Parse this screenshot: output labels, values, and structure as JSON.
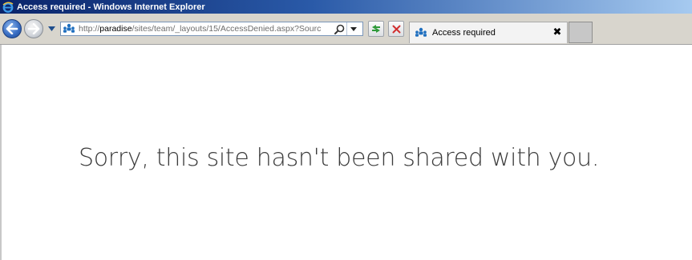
{
  "window": {
    "title": "Access required - Windows Internet Explorer"
  },
  "toolbar": {
    "back_icon": "back-arrow-icon",
    "forward_icon": "forward-arrow-icon",
    "address": {
      "prefix": "http://",
      "host": "paradise",
      "path": "/sites/team/_layouts/15/AccessDenied.aspx?Sourc",
      "favicon": "sharepoint-people-icon"
    },
    "search_icon": "search-icon",
    "refresh_icon": "refresh-icon",
    "stop_icon": "stop-icon"
  },
  "tabs": [
    {
      "label": "Access required",
      "icon": "sharepoint-people-icon",
      "close_glyph": "✖"
    }
  ],
  "page": {
    "message": "Sorry, this site hasn't been shared with you."
  },
  "colors": {
    "title_bar": "#0a246a",
    "sharepoint_blue": "#1f6fbf",
    "stop_red": "#d12f2f",
    "refresh_green": "#2f9a3a"
  }
}
